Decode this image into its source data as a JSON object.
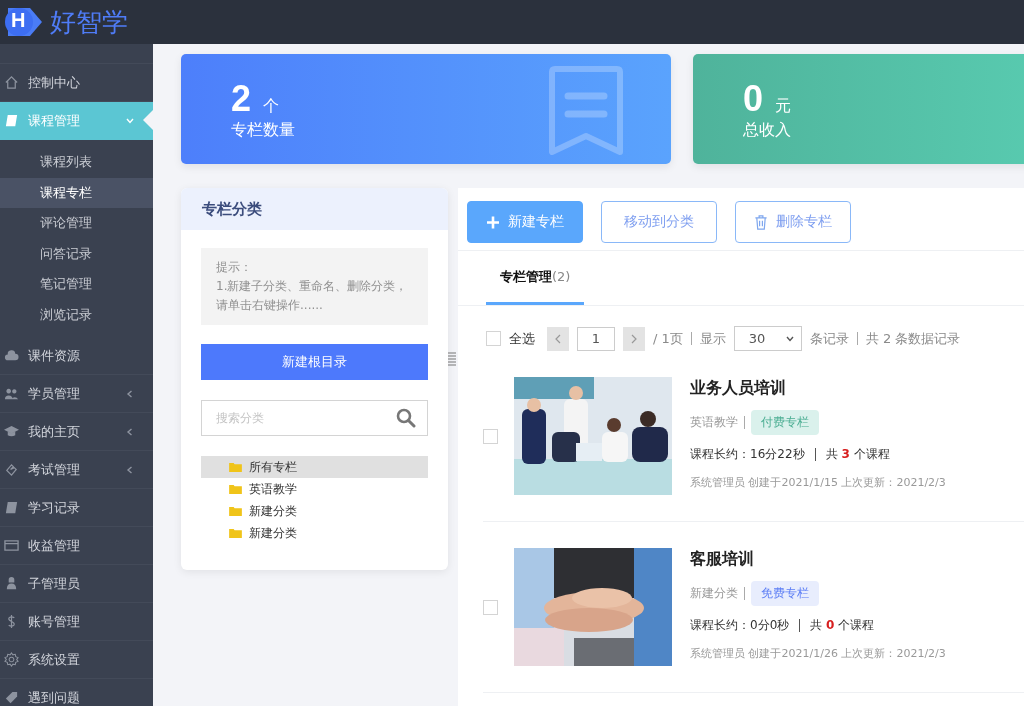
{
  "brand": {
    "mark": "H",
    "name": "好智学"
  },
  "sidebar": {
    "items": [
      {
        "label": "控制中心",
        "selected": false
      },
      {
        "label": "课程管理",
        "selected": true,
        "expanded": true,
        "children": [
          {
            "label": "课程列表",
            "selected": false
          },
          {
            "label": "课程专栏",
            "selected": true
          },
          {
            "label": "评论管理",
            "selected": false
          },
          {
            "label": "问答记录",
            "selected": false
          },
          {
            "label": "笔记管理",
            "selected": false
          },
          {
            "label": "浏览记录",
            "selected": false
          }
        ]
      },
      {
        "label": "课件资源",
        "selected": false
      },
      {
        "label": "学员管理",
        "selected": false,
        "expanded": false
      },
      {
        "label": "我的主页",
        "selected": false,
        "expanded": false
      },
      {
        "label": "考试管理",
        "selected": false,
        "expanded": false
      },
      {
        "label": "学习记录",
        "selected": false
      },
      {
        "label": "收益管理",
        "selected": false
      },
      {
        "label": "子管理员",
        "selected": false
      },
      {
        "label": "账号管理",
        "selected": false
      },
      {
        "label": "系统设置",
        "selected": false
      },
      {
        "label": "遇到问题",
        "selected": false
      }
    ]
  },
  "stats": [
    {
      "value": "2",
      "unit": "个",
      "label": "专栏数量",
      "kind": "blue"
    },
    {
      "value": "0",
      "unit": "元",
      "label": "总收入",
      "kind": "green"
    }
  ],
  "category_panel": {
    "title": "专栏分类",
    "hint": [
      "提示：",
      "1.新建子分类、重命名、删除分类，请单击右键操作......"
    ],
    "new_root_button": "新建根目录",
    "search": {
      "placeholder": "搜索分类"
    },
    "tree": [
      {
        "label": "所有专栏",
        "selected": true
      },
      {
        "label": "英语教学",
        "selected": false
      },
      {
        "label": "新建分类",
        "selected": false
      },
      {
        "label": "新建分类",
        "selected": false
      }
    ]
  },
  "toolbar": [
    {
      "label": "新建专栏",
      "kind": "primary"
    },
    {
      "label": "移动到分类",
      "kind": "outline"
    },
    {
      "label": "删除专栏",
      "kind": "delete"
    }
  ],
  "tabs": [
    {
      "label": "专栏管理",
      "count": "(2)",
      "selected": true
    }
  ],
  "pager": {
    "select_all": {
      "label": "全选",
      "checked": false
    },
    "page": "1",
    "total_pages": "/ 1页",
    "show_label": "显示",
    "page_size": "30",
    "per_page_suffix": "条记录",
    "total": "共 2 条数据记录"
  },
  "columns": [
    {
      "title": "业务人员培训",
      "category": "英语教学",
      "tag": {
        "label": "付费专栏",
        "kind": "paid"
      },
      "duration": "课程长约：16分22秒",
      "count": "共 **3** 个课程",
      "meta": "系统管理员 创建于2021/1/15 上次更新：2021/2/3",
      "checked": false
    },
    {
      "title": "客服培训",
      "category": "新建分类",
      "tag": {
        "label": "免费专栏",
        "kind": "free"
      },
      "duration": "课程长约：0分0秒",
      "count": "共 **0** 个课程",
      "meta": "系统管理员 创建于2021/1/26 上次更新：2021/2/3",
      "checked": false
    }
  ]
}
